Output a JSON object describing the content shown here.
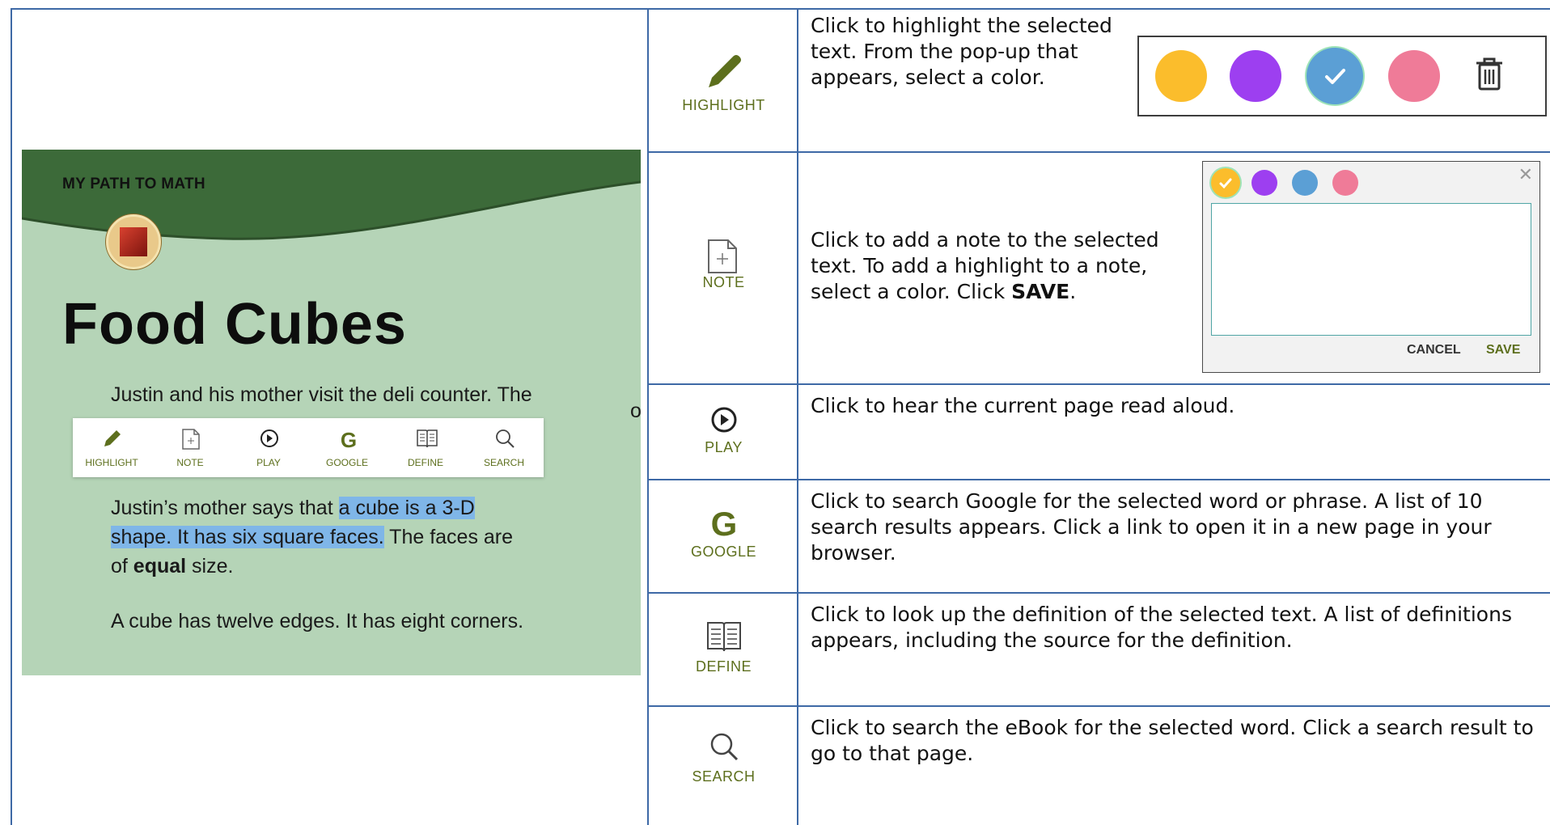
{
  "book": {
    "series": "MY PATH TO MATH",
    "title": "Food Cubes",
    "p1": "Justin and his mother visit the deli counter. The",
    "p1_tail": "of",
    "p2_pre": "Justin’s mother says that ",
    "p2_hl": "a cube is a 3-D shape. It has six square faces.",
    "p2_mid": " The faces are of ",
    "p2_bold": "equal",
    "p2_end": " size.",
    "p3": "A cube has twelve edges. It has eight corners."
  },
  "toolbar": {
    "items": [
      {
        "label": "HIGHLIGHT",
        "icon": "pencil-icon"
      },
      {
        "label": "NOTE",
        "icon": "note-icon"
      },
      {
        "label": "PLAY",
        "icon": "play-icon"
      },
      {
        "label": "GOOGLE",
        "icon": "google-icon"
      },
      {
        "label": "DEFINE",
        "icon": "book-icon"
      },
      {
        "label": "SEARCH",
        "icon": "search-icon"
      }
    ]
  },
  "rows": {
    "highlight": {
      "label": "HIGHLIGHT",
      "desc": "Click to highlight the selected text. From the pop-up that appears, select a color."
    },
    "note": {
      "label": "NOTE",
      "desc_pre": "Click to add a note to the selected text. To add a highlight to a note, select a color. Click ",
      "desc_bold": "SAVE",
      "desc_post": "."
    },
    "play": {
      "label": "PLAY",
      "desc": "Click to hear the current page read aloud."
    },
    "google": {
      "label": "GOOGLE",
      "desc": "Click to search Google for the selected word or phrase. A list of 10 search results appears. Click a link to open it in a new page in your browser."
    },
    "define": {
      "label": "DEFINE",
      "desc": "Click to look up the definition of the selected text. A list of definitions appears, including the source for the definition."
    },
    "search": {
      "label": "SEARCH",
      "desc": "Click to search the eBook for the selected word. Click a search result to go to that page."
    }
  },
  "highlight_colors": [
    "#fbbd2c",
    "#9d3ff0",
    "#5b9fd5",
    "#ef7b98"
  ],
  "note_popup": {
    "cancel": "CANCEL",
    "save": "SAVE"
  },
  "colors": {
    "accent_green": "#5d6f1d",
    "border_blue": "#3e69a6",
    "book_bg": "#b5d4b7",
    "book_header": "#3c6a39"
  }
}
